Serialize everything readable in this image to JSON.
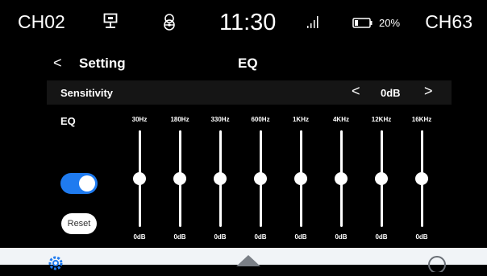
{
  "status_bar": {
    "channel_left": "CH02",
    "time": "11:30",
    "battery_percent": "20%",
    "channel_right": "CH63",
    "icons": [
      "network-icon",
      "steering-wheel-icon",
      "signal-bars-icon",
      "battery-icon"
    ]
  },
  "header": {
    "back_symbol": "<",
    "title": "Setting",
    "page_title": "EQ"
  },
  "sensitivity": {
    "label": "Sensitivity",
    "prev_symbol": "<",
    "value": "0dB",
    "next_symbol": ">"
  },
  "eq": {
    "label": "EQ",
    "enabled": true,
    "reset_label": "Reset",
    "gain_range_db": [
      -12,
      12
    ],
    "bands": [
      {
        "freq": "30Hz",
        "gain_label": "0dB",
        "gain_db": 0
      },
      {
        "freq": "180Hz",
        "gain_label": "0dB",
        "gain_db": 0
      },
      {
        "freq": "330Hz",
        "gain_label": "0dB",
        "gain_db": 0
      },
      {
        "freq": "600Hz",
        "gain_label": "0dB",
        "gain_db": 0
      },
      {
        "freq": "1KHz",
        "gain_label": "0dB",
        "gain_db": 0
      },
      {
        "freq": "4KHz",
        "gain_label": "0dB",
        "gain_db": 0
      },
      {
        "freq": "12KHz",
        "gain_label": "0dB",
        "gain_db": 0
      },
      {
        "freq": "16KHz",
        "gain_label": "0dB",
        "gain_db": 0
      }
    ]
  },
  "bottom_bar": {
    "icons": [
      "settings-gear-icon",
      "home-icon",
      "search-icon"
    ]
  },
  "colors": {
    "background": "#000000",
    "accent": "#1f7bf0",
    "row_background": "#151515",
    "bottom_bar": "#f1f4f7"
  }
}
